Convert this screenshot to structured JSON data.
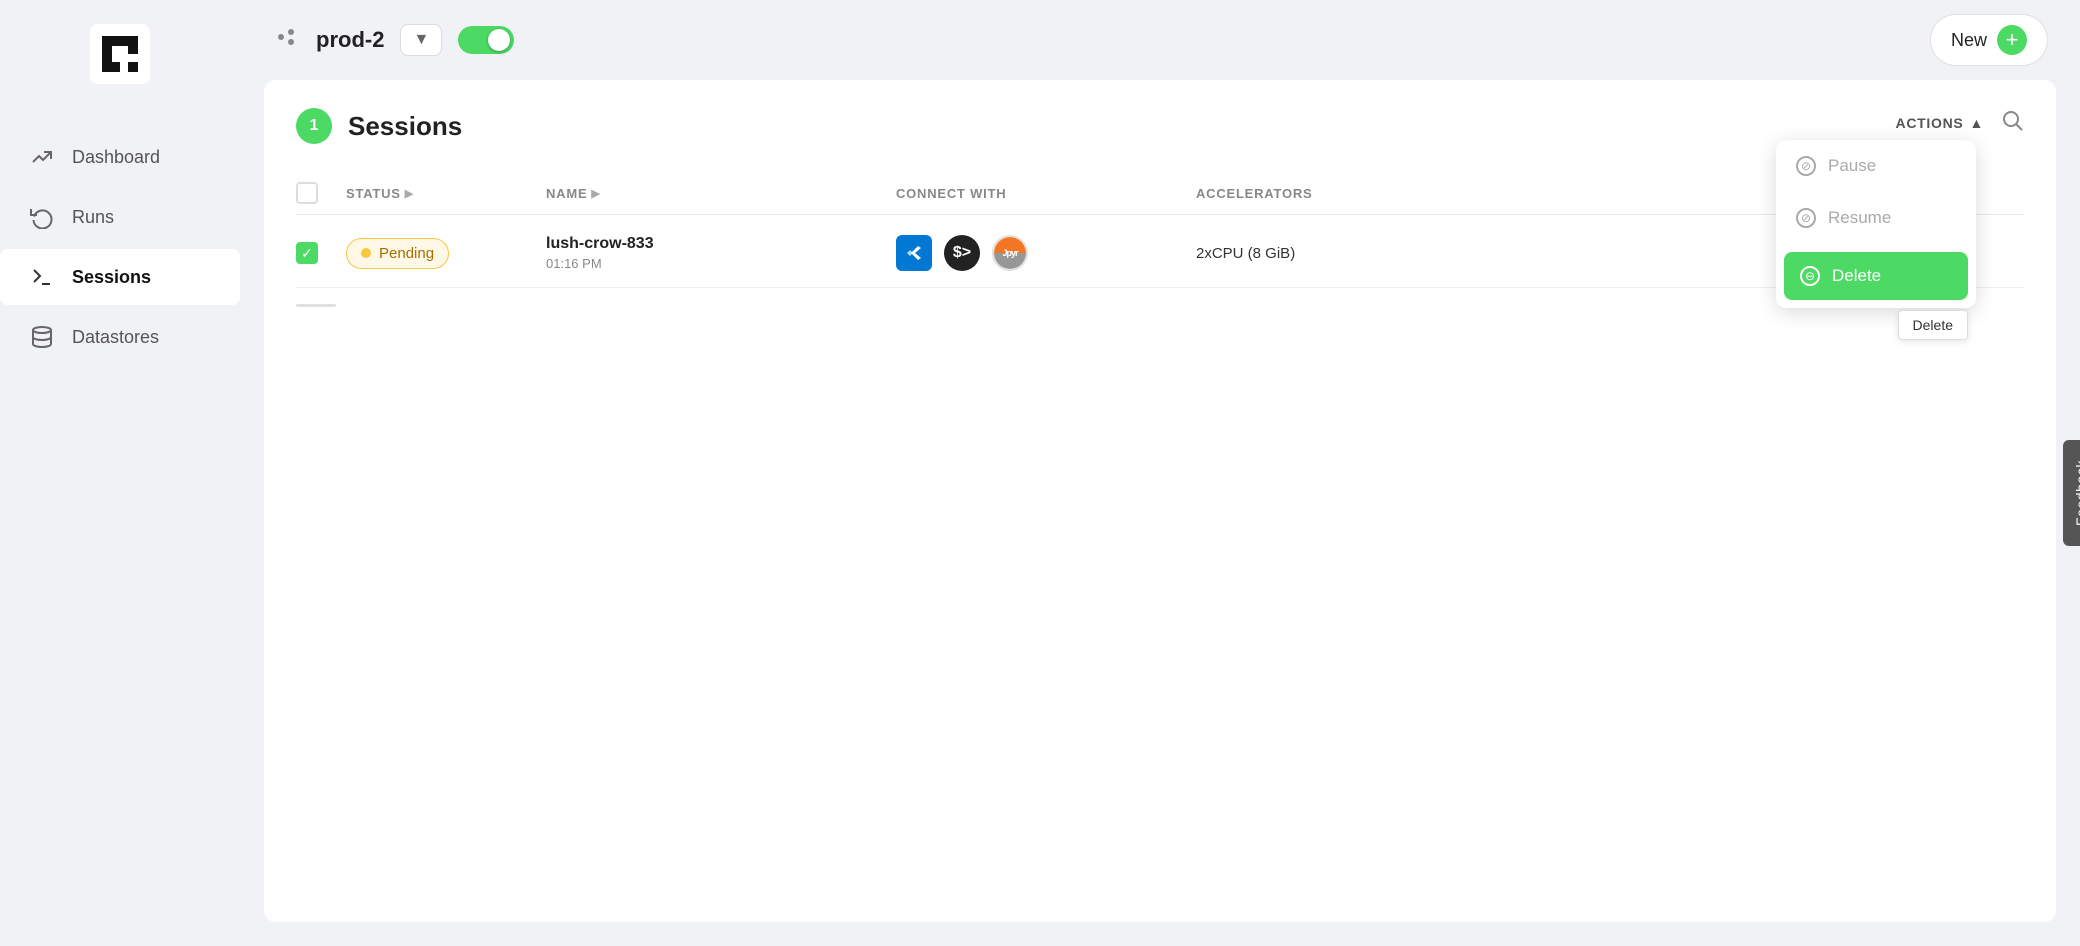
{
  "sidebar": {
    "logo_alt": "Grid logo",
    "items": [
      {
        "id": "dashboard",
        "label": "Dashboard",
        "icon": "📈",
        "active": false
      },
      {
        "id": "runs",
        "label": "Runs",
        "icon": "⟳",
        "active": false
      },
      {
        "id": "sessions",
        "label": "Sessions",
        "icon": "⬛",
        "active": true
      },
      {
        "id": "datastores",
        "label": "Datastores",
        "icon": "🗂",
        "active": false
      }
    ]
  },
  "topbar": {
    "project_icon": "⬡",
    "project_name": "prod-2",
    "toggle_on": true,
    "new_button_label": "New",
    "new_button_plus": "+"
  },
  "sessions": {
    "count": "1",
    "title": "Sessions",
    "actions_label": "ACTIONS",
    "columns": {
      "status": "STATUS",
      "name": "NAME",
      "connect_with": "CONNECT WITH",
      "accelerators": "ACCELERATORS"
    },
    "rows": [
      {
        "checked": true,
        "status": "Pending",
        "name": "lush-crow-833",
        "time": "01:16 PM",
        "accelerators": "2xCPU (8 GiB)"
      }
    ]
  },
  "actions_menu": {
    "pause_label": "Pause",
    "resume_label": "Resume",
    "delete_label": "Delete",
    "delete_tooltip": "Delete"
  },
  "feedback": {
    "label": "Feedback"
  }
}
